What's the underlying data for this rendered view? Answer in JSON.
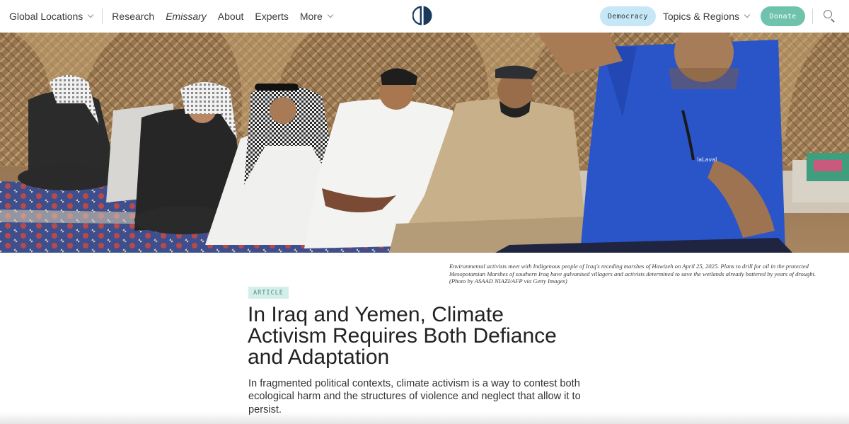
{
  "header": {
    "global_locations": "Global Locations",
    "nav": {
      "research": "Research",
      "emissary": "Emissary",
      "about": "About",
      "experts": "Experts",
      "more": "More"
    },
    "democracy": "Democracy",
    "topics_regions": "Topics & Regions",
    "donate": "Donate"
  },
  "hero": {
    "caption": "Environmental activists meet with Indigenous people of Iraq's receding marshes of Hawizeh on April 25, 2025. Plans to drill for oil in the protected Mesopotamian Marshes of southern Iraq have galvanised villagers and activists determined to save the wetlands already battered by years of drought. (Photo by ASAAD NIAZI/AFP via Getty Images)",
    "shirt_text": "laLaval"
  },
  "article": {
    "tag": "ARTICLE",
    "title": "In Iraq and Yemen, Climate Activism Requires Both Defiance and Adaptation",
    "dek": "In fragmented political contexts, climate activism is a way to contest both ecological harm and the structures of violence and neglect that allow it to persist."
  },
  "colors": {
    "democracy_pill": "#c6e7f7",
    "donate_pill": "#6fc3ac",
    "tag_bg": "#d4efe9",
    "logo_navy": "#17395a"
  },
  "icons": {
    "logo": "carnegie-logo-icon",
    "search": "search-icon",
    "chevron": "chevron-down-icon"
  }
}
